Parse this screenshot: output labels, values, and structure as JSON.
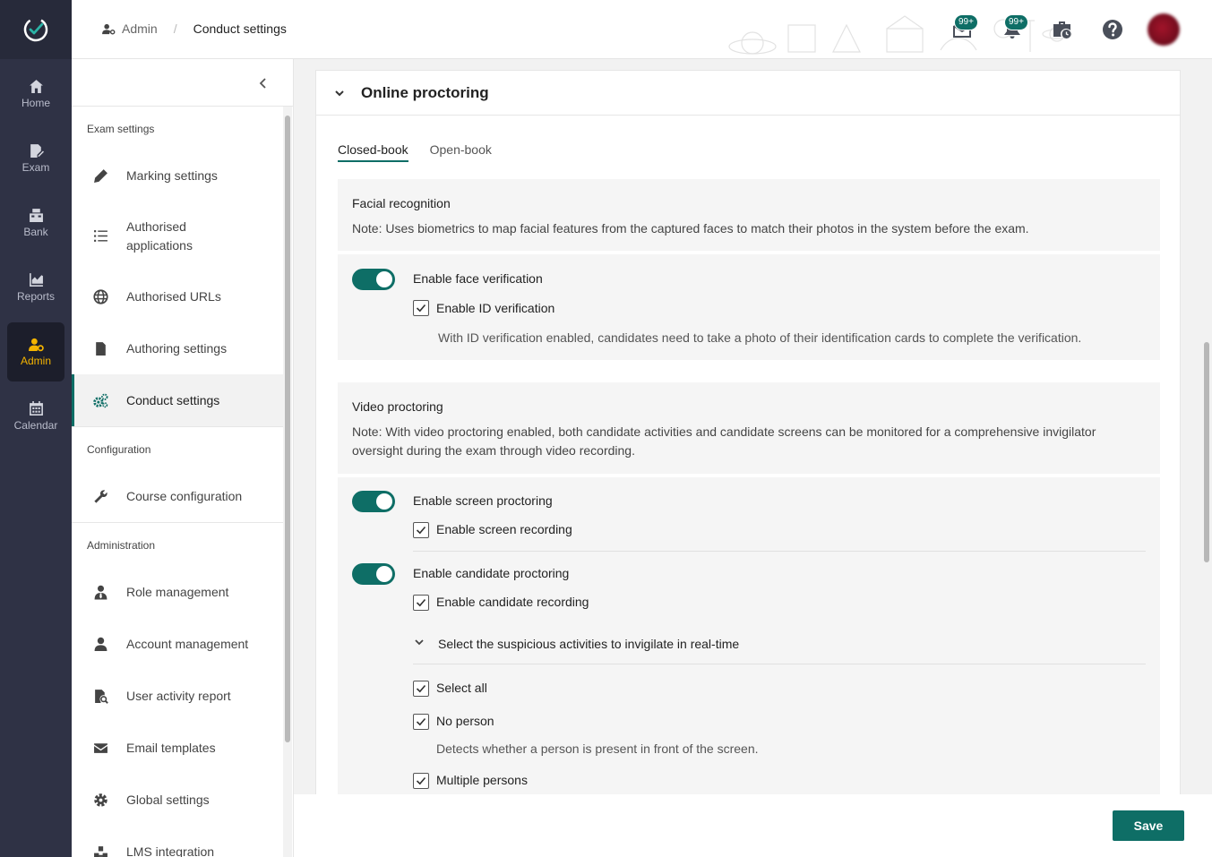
{
  "rail": {
    "items": [
      {
        "label": "Home",
        "icon": "home-icon"
      },
      {
        "label": "Exam",
        "icon": "exam-icon"
      },
      {
        "label": "Bank",
        "icon": "bank-icon"
      },
      {
        "label": "Reports",
        "icon": "reports-icon"
      },
      {
        "label": "Admin",
        "icon": "admin-icon"
      },
      {
        "label": "Calendar",
        "icon": "calendar-icon"
      }
    ],
    "active": "Admin",
    "active_color": "#f4b400"
  },
  "header": {
    "breadcrumb": {
      "root": "Admin",
      "separator": "/",
      "current": "Conduct settings"
    },
    "message_badge": "99+",
    "notification_badge": "99+"
  },
  "sidebar": {
    "groups": [
      {
        "title": "Exam settings"
      },
      {
        "title": "Configuration"
      },
      {
        "title": "Administration"
      }
    ],
    "items": {
      "marking": "Marking settings",
      "authorised_apps": "Authorised applications",
      "authorised_urls": "Authorised URLs",
      "authoring": "Authoring settings",
      "conduct": "Conduct settings",
      "course": "Course configuration",
      "role": "Role management",
      "account": "Account management",
      "user_activity": "User activity report",
      "email": "Email templates",
      "global": "Global settings",
      "lms": "LMS integration"
    }
  },
  "main": {
    "section_title": "Online proctoring",
    "tabs": [
      {
        "label": "Closed-book",
        "active": true
      },
      {
        "label": "Open-book",
        "active": false
      }
    ],
    "facial": {
      "title": "Facial recognition",
      "note": "Note: Uses biometrics to map facial features from the captured faces to match their photos in the system before the exam.",
      "face_toggle": "Enable face verification",
      "id_checkbox": "Enable ID verification",
      "id_desc": "With ID verification enabled, candidates need to take a photo of their identification cards to complete the verification."
    },
    "video": {
      "title": "Video proctoring",
      "note": "Note: With video proctoring enabled, both candidate activities and candidate screens can be monitored for a comprehensive invigilator oversight during the exam through video recording.",
      "screen_toggle": "Enable screen proctoring",
      "screen_recording": "Enable screen recording",
      "candidate_toggle": "Enable candidate proctoring",
      "candidate_recording": "Enable candidate recording",
      "suspicious_header": "Select the suspicious activities to invigilate in real-time",
      "select_all": "Select all",
      "no_person": "No person",
      "no_person_desc": "Detects whether a person is present in front of the screen.",
      "multiple_persons": "Multiple persons"
    }
  },
  "footer": {
    "save_label": "Save"
  },
  "colors": {
    "accent": "#0e6e66",
    "rail": "#2f3245"
  }
}
